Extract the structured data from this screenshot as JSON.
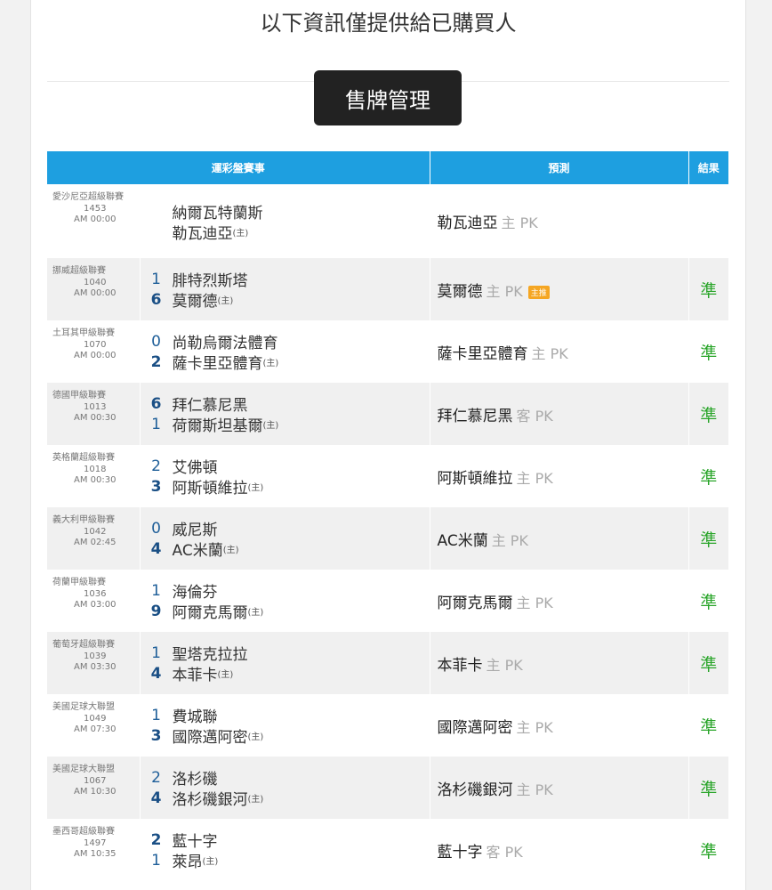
{
  "notice": "以下資訊僅提供給已購買人",
  "section_title": "售牌管理",
  "table": {
    "headers": {
      "event": "運彩盤賽事",
      "prediction": "預測",
      "result": "結果"
    },
    "host_mark": "(主)",
    "rows": [
      {
        "league": "愛沙尼亞超級聯賽",
        "num": "1453",
        "time": "AM 00:00",
        "away": "納爾瓦特蘭斯",
        "home": "勒瓦迪亞",
        "away_score": "",
        "home_score": "",
        "pick": "勒瓦迪亞",
        "side": "主 PK",
        "badge": "",
        "result": ""
      },
      {
        "league": "挪威超級聯賽",
        "num": "1040",
        "time": "AM 00:00",
        "away": "腓特烈斯塔",
        "home": "莫爾德",
        "away_score": "1",
        "home_score": "6",
        "pick": "莫爾德",
        "side": "主 PK",
        "badge": "主推",
        "result": "準"
      },
      {
        "league": "土耳其甲級聯賽",
        "num": "1070",
        "time": "AM 00:00",
        "away": "尚勒烏爾法體育",
        "home": "薩卡里亞體育",
        "away_score": "0",
        "home_score": "2",
        "pick": "薩卡里亞體育",
        "side": "主 PK",
        "badge": "",
        "result": "準"
      },
      {
        "league": "德國甲級聯賽",
        "num": "1013",
        "time": "AM 00:30",
        "away": "拜仁慕尼黑",
        "home": "荷爾斯坦基爾",
        "away_score": "6",
        "home_score": "1",
        "pick": "拜仁慕尼黑",
        "side": "客 PK",
        "badge": "",
        "result": "準"
      },
      {
        "league": "英格蘭超級聯賽",
        "num": "1018",
        "time": "AM 00:30",
        "away": "艾佛頓",
        "home": "阿斯頓維拉",
        "away_score": "2",
        "home_score": "3",
        "pick": "阿斯頓維拉",
        "side": "主 PK",
        "badge": "",
        "result": "準"
      },
      {
        "league": "義大利甲級聯賽",
        "num": "1042",
        "time": "AM 02:45",
        "away": "威尼斯",
        "home": "AC米蘭",
        "away_score": "0",
        "home_score": "4",
        "pick": "AC米蘭",
        "side": "主 PK",
        "badge": "",
        "result": "準"
      },
      {
        "league": "荷蘭甲級聯賽",
        "num": "1036",
        "time": "AM 03:00",
        "away": "海倫芬",
        "home": "阿爾克馬爾",
        "away_score": "1",
        "home_score": "9",
        "pick": "阿爾克馬爾",
        "side": "主 PK",
        "badge": "",
        "result": "準"
      },
      {
        "league": "葡萄牙超級聯賽",
        "num": "1039",
        "time": "AM 03:30",
        "away": "聖塔克拉拉",
        "home": "本菲卡",
        "away_score": "1",
        "home_score": "4",
        "pick": "本菲卡",
        "side": "主 PK",
        "badge": "",
        "result": "準"
      },
      {
        "league": "美國足球大聯盟",
        "num": "1049",
        "time": "AM 07:30",
        "away": "費城聯",
        "home": "國際邁阿密",
        "away_score": "1",
        "home_score": "3",
        "pick": "國際邁阿密",
        "side": "主 PK",
        "badge": "",
        "result": "準"
      },
      {
        "league": "美國足球大聯盟",
        "num": "1067",
        "time": "AM 10:30",
        "away": "洛杉磯",
        "home": "洛杉磯銀河",
        "away_score": "2",
        "home_score": "4",
        "pick": "洛杉磯銀河",
        "side": "主 PK",
        "badge": "",
        "result": "準"
      },
      {
        "league": "墨西哥超級聯賽",
        "num": "1497",
        "time": "AM 10:35",
        "away": "藍十字",
        "home": "萊昂",
        "away_score": "2",
        "home_score": "1",
        "pick": "藍十字",
        "side": "客 PK",
        "badge": "",
        "result": "準"
      }
    ]
  }
}
